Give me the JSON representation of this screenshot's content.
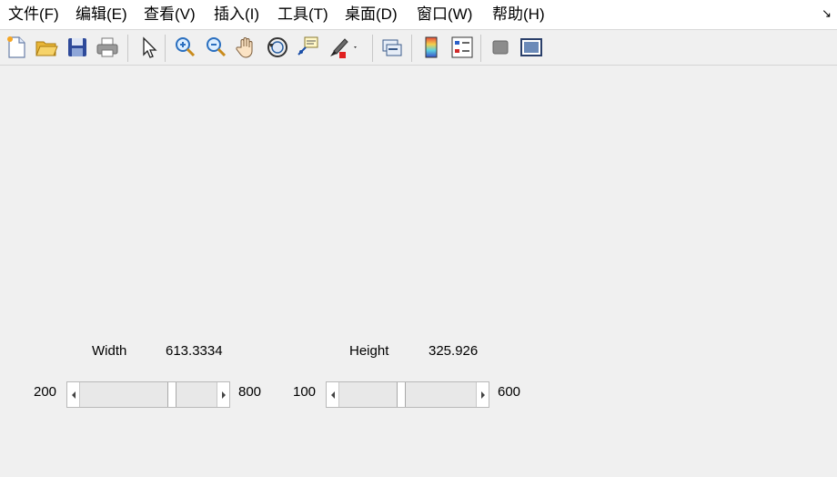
{
  "menubar": {
    "items": [
      {
        "label": "文件(F)"
      },
      {
        "label": "编辑(E)"
      },
      {
        "label": "查看(V)"
      },
      {
        "label": "插入(I)"
      },
      {
        "label": "工具(T)"
      },
      {
        "label": "桌面(D)"
      },
      {
        "label": "窗口(W)"
      },
      {
        "label": "帮助(H)"
      }
    ],
    "dock_arrow": "↘"
  },
  "toolbar": {
    "buttons": [
      "new-file-icon",
      "open-folder-icon",
      "save-icon",
      "print-icon",
      "pointer-icon",
      "zoom-in-icon",
      "zoom-out-icon",
      "pan-hand-icon",
      "rotate-3d-icon",
      "data-cursor-icon",
      "brush-icon",
      "link-plot-icon",
      "colorbar-icon",
      "legend-icon",
      "hide-plot-tools-icon",
      "show-plot-tools-icon"
    ]
  },
  "controls": {
    "width": {
      "label": "Width",
      "value": "613.3334",
      "min": "200",
      "max": "800",
      "fraction": 0.689
    },
    "height": {
      "label": "Height",
      "value": "325.926",
      "min": "100",
      "max": "600",
      "fraction": 0.452
    }
  }
}
